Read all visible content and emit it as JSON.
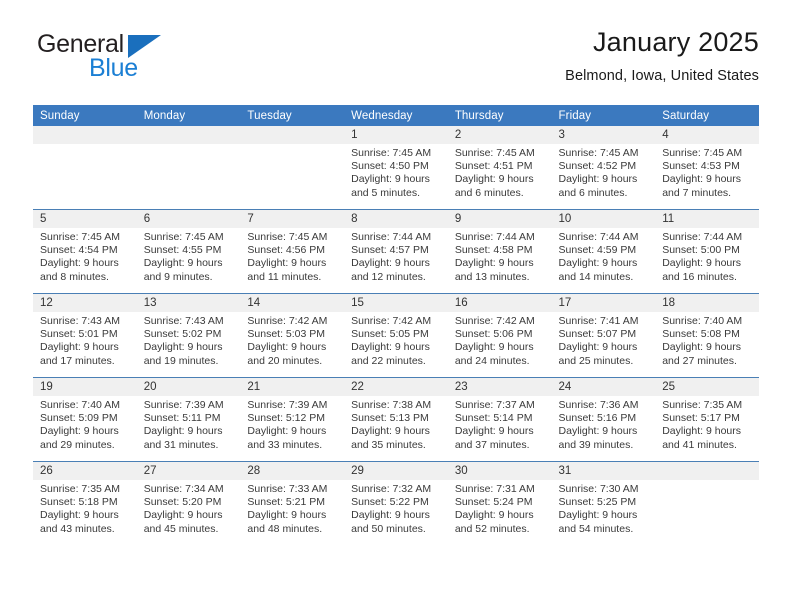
{
  "brand": {
    "name_top": "General",
    "name_bottom": "Blue",
    "triangle_color": "#1a6fbd",
    "blue_text_color": "#1b7fd4"
  },
  "header": {
    "title": "January 2025",
    "location": "Belmond, Iowa, United States"
  },
  "calendar": {
    "header_bg": "#3b79bf",
    "daynum_bg": "#f0f0f0",
    "row_line_color": "#4a7fb5",
    "weekday_headers": [
      "Sunday",
      "Monday",
      "Tuesday",
      "Wednesday",
      "Thursday",
      "Friday",
      "Saturday"
    ],
    "weeks": [
      [
        {
          "day": "",
          "empty": true,
          "lines": []
        },
        {
          "day": "",
          "empty": true,
          "lines": []
        },
        {
          "day": "",
          "empty": true,
          "lines": []
        },
        {
          "day": "1",
          "empty": false,
          "lines": [
            "Sunrise: 7:45 AM",
            "Sunset: 4:50 PM",
            "Daylight: 9 hours",
            "and 5 minutes."
          ]
        },
        {
          "day": "2",
          "empty": false,
          "lines": [
            "Sunrise: 7:45 AM",
            "Sunset: 4:51 PM",
            "Daylight: 9 hours",
            "and 6 minutes."
          ]
        },
        {
          "day": "3",
          "empty": false,
          "lines": [
            "Sunrise: 7:45 AM",
            "Sunset: 4:52 PM",
            "Daylight: 9 hours",
            "and 6 minutes."
          ]
        },
        {
          "day": "4",
          "empty": false,
          "lines": [
            "Sunrise: 7:45 AM",
            "Sunset: 4:53 PM",
            "Daylight: 9 hours",
            "and 7 minutes."
          ]
        }
      ],
      [
        {
          "day": "5",
          "empty": false,
          "lines": [
            "Sunrise: 7:45 AM",
            "Sunset: 4:54 PM",
            "Daylight: 9 hours",
            "and 8 minutes."
          ]
        },
        {
          "day": "6",
          "empty": false,
          "lines": [
            "Sunrise: 7:45 AM",
            "Sunset: 4:55 PM",
            "Daylight: 9 hours",
            "and 9 minutes."
          ]
        },
        {
          "day": "7",
          "empty": false,
          "lines": [
            "Sunrise: 7:45 AM",
            "Sunset: 4:56 PM",
            "Daylight: 9 hours",
            "and 11 minutes."
          ]
        },
        {
          "day": "8",
          "empty": false,
          "lines": [
            "Sunrise: 7:44 AM",
            "Sunset: 4:57 PM",
            "Daylight: 9 hours",
            "and 12 minutes."
          ]
        },
        {
          "day": "9",
          "empty": false,
          "lines": [
            "Sunrise: 7:44 AM",
            "Sunset: 4:58 PM",
            "Daylight: 9 hours",
            "and 13 minutes."
          ]
        },
        {
          "day": "10",
          "empty": false,
          "lines": [
            "Sunrise: 7:44 AM",
            "Sunset: 4:59 PM",
            "Daylight: 9 hours",
            "and 14 minutes."
          ]
        },
        {
          "day": "11",
          "empty": false,
          "lines": [
            "Sunrise: 7:44 AM",
            "Sunset: 5:00 PM",
            "Daylight: 9 hours",
            "and 16 minutes."
          ]
        }
      ],
      [
        {
          "day": "12",
          "empty": false,
          "lines": [
            "Sunrise: 7:43 AM",
            "Sunset: 5:01 PM",
            "Daylight: 9 hours",
            "and 17 minutes."
          ]
        },
        {
          "day": "13",
          "empty": false,
          "lines": [
            "Sunrise: 7:43 AM",
            "Sunset: 5:02 PM",
            "Daylight: 9 hours",
            "and 19 minutes."
          ]
        },
        {
          "day": "14",
          "empty": false,
          "lines": [
            "Sunrise: 7:42 AM",
            "Sunset: 5:03 PM",
            "Daylight: 9 hours",
            "and 20 minutes."
          ]
        },
        {
          "day": "15",
          "empty": false,
          "lines": [
            "Sunrise: 7:42 AM",
            "Sunset: 5:05 PM",
            "Daylight: 9 hours",
            "and 22 minutes."
          ]
        },
        {
          "day": "16",
          "empty": false,
          "lines": [
            "Sunrise: 7:42 AM",
            "Sunset: 5:06 PM",
            "Daylight: 9 hours",
            "and 24 minutes."
          ]
        },
        {
          "day": "17",
          "empty": false,
          "lines": [
            "Sunrise: 7:41 AM",
            "Sunset: 5:07 PM",
            "Daylight: 9 hours",
            "and 25 minutes."
          ]
        },
        {
          "day": "18",
          "empty": false,
          "lines": [
            "Sunrise: 7:40 AM",
            "Sunset: 5:08 PM",
            "Daylight: 9 hours",
            "and 27 minutes."
          ]
        }
      ],
      [
        {
          "day": "19",
          "empty": false,
          "lines": [
            "Sunrise: 7:40 AM",
            "Sunset: 5:09 PM",
            "Daylight: 9 hours",
            "and 29 minutes."
          ]
        },
        {
          "day": "20",
          "empty": false,
          "lines": [
            "Sunrise: 7:39 AM",
            "Sunset: 5:11 PM",
            "Daylight: 9 hours",
            "and 31 minutes."
          ]
        },
        {
          "day": "21",
          "empty": false,
          "lines": [
            "Sunrise: 7:39 AM",
            "Sunset: 5:12 PM",
            "Daylight: 9 hours",
            "and 33 minutes."
          ]
        },
        {
          "day": "22",
          "empty": false,
          "lines": [
            "Sunrise: 7:38 AM",
            "Sunset: 5:13 PM",
            "Daylight: 9 hours",
            "and 35 minutes."
          ]
        },
        {
          "day": "23",
          "empty": false,
          "lines": [
            "Sunrise: 7:37 AM",
            "Sunset: 5:14 PM",
            "Daylight: 9 hours",
            "and 37 minutes."
          ]
        },
        {
          "day": "24",
          "empty": false,
          "lines": [
            "Sunrise: 7:36 AM",
            "Sunset: 5:16 PM",
            "Daylight: 9 hours",
            "and 39 minutes."
          ]
        },
        {
          "day": "25",
          "empty": false,
          "lines": [
            "Sunrise: 7:35 AM",
            "Sunset: 5:17 PM",
            "Daylight: 9 hours",
            "and 41 minutes."
          ]
        }
      ],
      [
        {
          "day": "26",
          "empty": false,
          "lines": [
            "Sunrise: 7:35 AM",
            "Sunset: 5:18 PM",
            "Daylight: 9 hours",
            "and 43 minutes."
          ]
        },
        {
          "day": "27",
          "empty": false,
          "lines": [
            "Sunrise: 7:34 AM",
            "Sunset: 5:20 PM",
            "Daylight: 9 hours",
            "and 45 minutes."
          ]
        },
        {
          "day": "28",
          "empty": false,
          "lines": [
            "Sunrise: 7:33 AM",
            "Sunset: 5:21 PM",
            "Daylight: 9 hours",
            "and 48 minutes."
          ]
        },
        {
          "day": "29",
          "empty": false,
          "lines": [
            "Sunrise: 7:32 AM",
            "Sunset: 5:22 PM",
            "Daylight: 9 hours",
            "and 50 minutes."
          ]
        },
        {
          "day": "30",
          "empty": false,
          "lines": [
            "Sunrise: 7:31 AM",
            "Sunset: 5:24 PM",
            "Daylight: 9 hours",
            "and 52 minutes."
          ]
        },
        {
          "day": "31",
          "empty": false,
          "lines": [
            "Sunrise: 7:30 AM",
            "Sunset: 5:25 PM",
            "Daylight: 9 hours",
            "and 54 minutes."
          ]
        },
        {
          "day": "",
          "empty": true,
          "lines": []
        }
      ]
    ]
  }
}
